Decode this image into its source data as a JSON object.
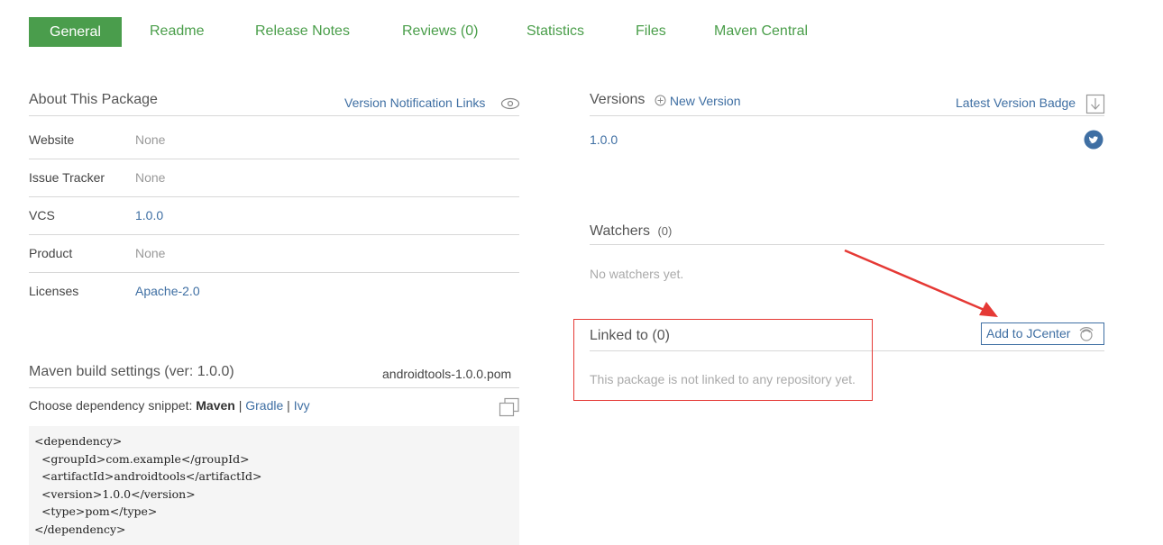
{
  "tabs": [
    {
      "label": "General"
    },
    {
      "label": "Readme"
    },
    {
      "label": "Release Notes"
    },
    {
      "label": "Reviews (0)"
    },
    {
      "label": "Statistics"
    },
    {
      "label": "Files"
    },
    {
      "label": "Maven Central"
    }
  ],
  "about": {
    "title": "About This Package",
    "notification_link": "Version Notification Links",
    "rows": [
      {
        "label": "Website",
        "value": "None"
      },
      {
        "label": "Issue Tracker",
        "value": "None"
      },
      {
        "label": "VCS",
        "value": "1.0.0"
      },
      {
        "label": "Product",
        "value": "None"
      },
      {
        "label": "Licenses",
        "value": "Apache-2.0"
      }
    ]
  },
  "maven": {
    "title": "Maven build settings (ver: 1.0.0)",
    "pom_file": "androidtools-1.0.0.pom",
    "choose_label": "Choose dependency snippet:",
    "snippet_maven": "Maven",
    "sep": "|",
    "snippet_gradle": "Gradle",
    "snippet_ivy": "Ivy",
    "code_lines": [
      "<dependency>",
      "  <groupId>com.example</groupId>",
      "  <artifactId>androidtools</artifactId>",
      "  <version>1.0.0</version>",
      "  <type>pom</type>",
      "</dependency>"
    ]
  },
  "versions": {
    "title": "Versions",
    "new_version": "New Version",
    "badge": "Latest Version Badge",
    "items": [
      "1.0.0"
    ]
  },
  "watchers": {
    "title": "Watchers",
    "count": "(0)",
    "empty": "No watchers yet."
  },
  "linked": {
    "title": "Linked to (0)",
    "empty": "This package is not linked to any repository yet.",
    "add_button": "Add to JCenter"
  },
  "colors": {
    "accent_green": "#4a9d4c",
    "link_blue": "#3f6fa3",
    "annotation_red": "#e53935"
  }
}
